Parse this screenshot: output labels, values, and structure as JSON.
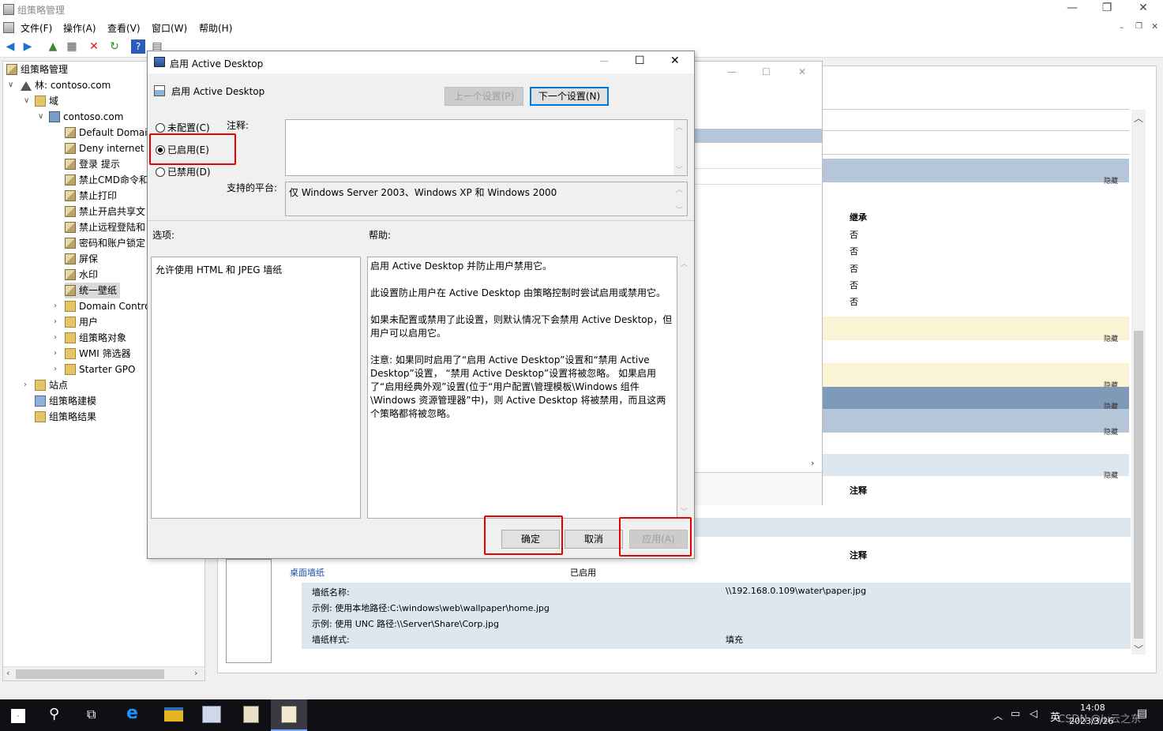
{
  "main_window": {
    "title": "组策略管理",
    "menu": [
      "文件(F)",
      "操作(A)",
      "查看(V)",
      "窗口(W)",
      "帮助(H)"
    ]
  },
  "tree": {
    "root": "组策略管理",
    "forest": "林: contoso.com",
    "domains": "域",
    "domain": "contoso.com",
    "gpos": [
      "Default Domai",
      "Deny internet",
      "登录 提示",
      "禁止CMD命令和",
      "禁止打印",
      "禁止开启共享文",
      "禁止远程登陆和",
      "密码和账户锁定",
      "屏保",
      "水印",
      "统一壁纸"
    ],
    "ous": [
      "Domain Contro",
      "用户",
      "组策略对象",
      "WMI 筛选器",
      "Starter GPO"
    ],
    "sites": "站点",
    "modeling": "组策略建模",
    "results": "组策略结果"
  },
  "right_pane": {
    "inherit_header": "继承",
    "inherit_values": [
      "否",
      "否",
      "否",
      "否",
      "否"
    ],
    "hide_label": "隐藏",
    "comment_header": "注释",
    "setting_name": "桌面墙纸",
    "setting_state": "已启用",
    "details": [
      {
        "label": "墙纸名称:",
        "value": "\\\\192.168.0.109\\water\\paper.jpg"
      },
      {
        "label": "示例: 使用本地路径:C:\\windows\\web\\wallpaper\\home.jpg",
        "value": ""
      },
      {
        "label": "示例: 使用 UNC 路径:\\\\Server\\Share\\Corp.jpg",
        "value": ""
      },
      {
        "label": "墙纸样式:",
        "value": "填充"
      }
    ]
  },
  "dialog": {
    "title": "启用 Active Desktop",
    "setting_title": "启用 Active Desktop",
    "prev_button": "上一个设置(P)",
    "next_button": "下一个设置(N)",
    "radio_not_configured": "未配置(C)",
    "radio_enabled": "已启用(E)",
    "radio_disabled": "已禁用(D)",
    "comment_label": "注释:",
    "platform_label": "支持的平台:",
    "platform_value": "仅 Windows Server 2003、Windows XP 和 Windows 2000",
    "options_label": "选项:",
    "help_label": "帮助:",
    "option_text": "允许使用 HTML 和 JPEG 墙纸",
    "help_paragraphs": [
      "启用 Active Desktop 并防止用户禁用它。",
      "此设置防止用户在 Active Desktop 由策略控制时尝试启用或禁用它。",
      "如果未配置或禁用了此设置，则默认情况下会禁用 Active Desktop，但用户可以启用它。",
      "注意: 如果同时启用了“启用 Active Desktop”设置和“禁用 Active Desktop”设置， “禁用 Active Desktop”设置将被忽略。 如果启用了“启用经典外观”设置(位于“用户配置\\管理模板\\Windows 组件\\Windows 资源管理器”中)，则 Active Desktop 将被禁用，而且这两个策略都将被忽略。"
    ],
    "ok_button": "确定",
    "cancel_button": "取消",
    "apply_button": "应用(A)"
  },
  "taskbar": {
    "time": "14:08",
    "date": "2023/3/26",
    "ime": "英",
    "watermark": "CSDN @lu云之东"
  },
  "colors": {
    "highlight_red": "#e60000",
    "band_blue": "#b4c6d8",
    "band_dark_blue": "#7d9ab8",
    "band_cream": "#fbf4d4",
    "taskbar": "#0f0f14"
  }
}
